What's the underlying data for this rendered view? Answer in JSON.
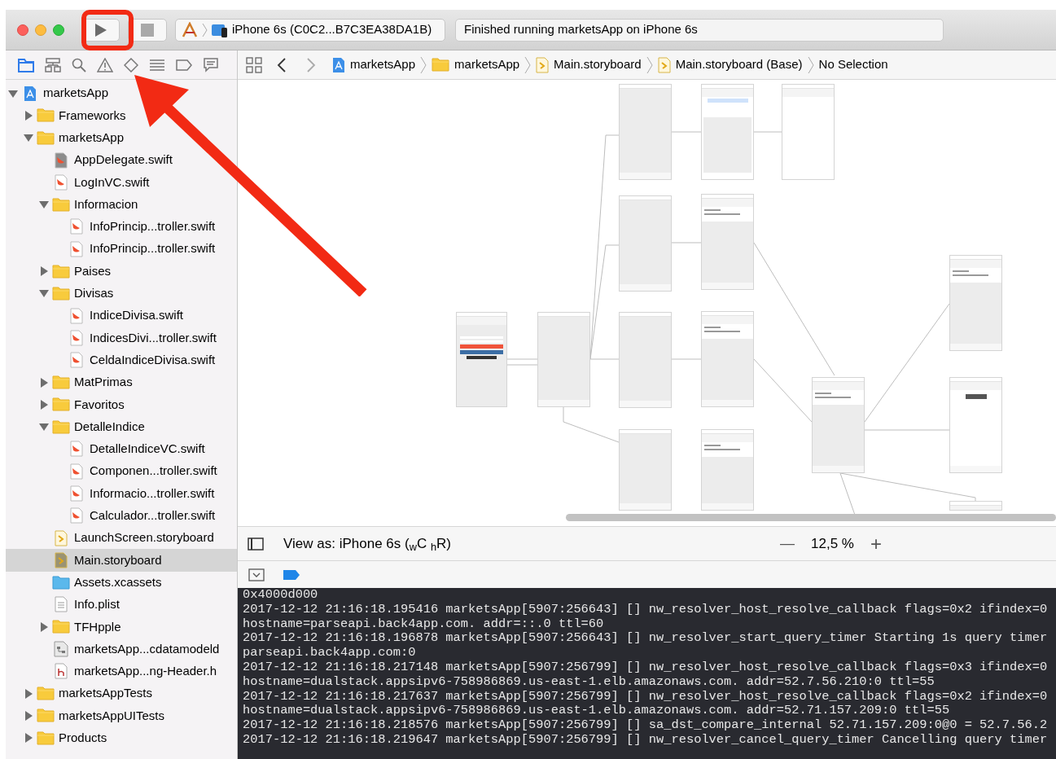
{
  "toolbar": {
    "scheme": "iPhone 6s (C0C2...B7C3EA38DA1B)",
    "status": "Finished running marketsApp on iPhone 6s"
  },
  "navigator": {
    "tree": [
      {
        "label": "marketsApp",
        "kind": "project",
        "expanded": true,
        "selected": false,
        "children": [
          {
            "label": "Frameworks",
            "kind": "folder",
            "expanded": false,
            "selected": false
          },
          {
            "label": "marketsApp",
            "kind": "folder",
            "expanded": true,
            "selected": false,
            "children": [
              {
                "label": "AppDelegate.swift",
                "kind": "swift-gray",
                "selected": false
              },
              {
                "label": "LogInVC.swift",
                "kind": "swift",
                "selected": false
              },
              {
                "label": "Informacion",
                "kind": "folder",
                "expanded": true,
                "selected": false,
                "children": [
                  {
                    "label": "InfoPrincip...troller.swift",
                    "kind": "swift",
                    "selected": false
                  },
                  {
                    "label": "InfoPrincip...troller.swift",
                    "kind": "swift",
                    "selected": false
                  }
                ]
              },
              {
                "label": "Paises",
                "kind": "folder",
                "expanded": false,
                "selected": false
              },
              {
                "label": "Divisas",
                "kind": "folder",
                "expanded": true,
                "selected": false,
                "children": [
                  {
                    "label": "IndiceDivisa.swift",
                    "kind": "swift",
                    "selected": false
                  },
                  {
                    "label": "IndicesDivi...troller.swift",
                    "kind": "swift",
                    "selected": false
                  },
                  {
                    "label": "CeldaIndiceDivisa.swift",
                    "kind": "swift",
                    "selected": false
                  }
                ]
              },
              {
                "label": "MatPrimas",
                "kind": "folder",
                "expanded": false,
                "selected": false
              },
              {
                "label": "Favoritos",
                "kind": "folder",
                "expanded": false,
                "selected": false
              },
              {
                "label": "DetalleIndice",
                "kind": "folder",
                "expanded": true,
                "selected": false,
                "children": [
                  {
                    "label": "DetalleIndiceVC.swift",
                    "kind": "swift",
                    "selected": false
                  },
                  {
                    "label": "Componen...troller.swift",
                    "kind": "swift",
                    "selected": false
                  },
                  {
                    "label": "Informacio...troller.swift",
                    "kind": "swift",
                    "selected": false
                  },
                  {
                    "label": "Calculador...troller.swift",
                    "kind": "swift",
                    "selected": false
                  }
                ]
              },
              {
                "label": "LaunchScreen.storyboard",
                "kind": "storyboard",
                "selected": false
              },
              {
                "label": "Main.storyboard",
                "kind": "storyboard-gray",
                "selected": true
              },
              {
                "label": "Assets.xcassets",
                "kind": "assets",
                "selected": false
              },
              {
                "label": "Info.plist",
                "kind": "plist",
                "selected": false
              },
              {
                "label": "TFHpple",
                "kind": "folder",
                "expanded": false,
                "selected": false
              },
              {
                "label": "marketsApp...cdatamodeld",
                "kind": "datamodel",
                "selected": false
              },
              {
                "label": "marketsApp...ng-Header.h",
                "kind": "header",
                "selected": false
              }
            ]
          },
          {
            "label": "marketsAppTests",
            "kind": "folder",
            "expanded": false,
            "selected": false
          },
          {
            "label": "marketsAppUITests",
            "kind": "folder",
            "expanded": false,
            "selected": false
          },
          {
            "label": "Products",
            "kind": "folder",
            "expanded": false,
            "selected": false
          }
        ]
      }
    ]
  },
  "jump_bar": [
    {
      "label": "marketsApp",
      "kind": "project"
    },
    {
      "label": "marketsApp",
      "kind": "folder"
    },
    {
      "label": "Main.storyboard",
      "kind": "storyboard"
    },
    {
      "label": "Main.storyboard (Base)",
      "kind": "storyboard"
    },
    {
      "label": "No Selection",
      "kind": "none"
    }
  ],
  "canvas": {
    "scenes": [
      {
        "kind": "login"
      },
      {
        "kind": "tabbar"
      },
      {
        "kind": "navigation"
      },
      {
        "kind": "navigation"
      },
      {
        "kind": "navigation"
      },
      {
        "kind": "navigation"
      },
      {
        "kind": "question"
      },
      {
        "kind": "table"
      },
      {
        "kind": "table"
      },
      {
        "kind": "table"
      },
      {
        "kind": "blank"
      },
      {
        "kind": "table"
      },
      {
        "kind": "table"
      },
      {
        "kind": "info"
      },
      {
        "kind": "blank"
      }
    ]
  },
  "view_as": {
    "text": "View as: iPhone 6s ($_{w}$C $_{h}$R)",
    "zoom_out": "—",
    "zoom": "12,5 %",
    "zoom_in": "+"
  },
  "console": {
    "lines": [
      "0x4000d000",
      "2017-12-12 21:16:18.195416 marketsApp[5907:256643] [] nw_resolver_host_resolve_callback flags=0x2 ifindex=0",
      "hostname=parseapi.back4app.com. addr=::.0 ttl=60",
      "2017-12-12 21:16:18.196878 marketsApp[5907:256643] [] nw_resolver_start_query_timer Starting 1s query timer",
      "parseapi.back4app.com:0",
      "2017-12-12 21:16:18.217148 marketsApp[5907:256799] [] nw_resolver_host_resolve_callback flags=0x3 ifindex=0",
      "hostname=dualstack.appsipv6-758986869.us-east-1.elb.amazonaws.com. addr=52.7.56.210:0 ttl=55",
      "2017-12-12 21:16:18.217637 marketsApp[5907:256799] [] nw_resolver_host_resolve_callback flags=0x2 ifindex=0",
      "hostname=dualstack.appsipv6-758986869.us-east-1.elb.amazonaws.com. addr=52.71.157.209:0 ttl=55",
      "2017-12-12 21:16:18.218576 marketsApp[5907:256799] [] sa_dst_compare_internal 52.71.157.209:0@0 = 52.7.56.2",
      "2017-12-12 21:16:18.219647 marketsApp[5907:256799] [] nw_resolver_cancel_query_timer Cancelling query timer"
    ]
  }
}
